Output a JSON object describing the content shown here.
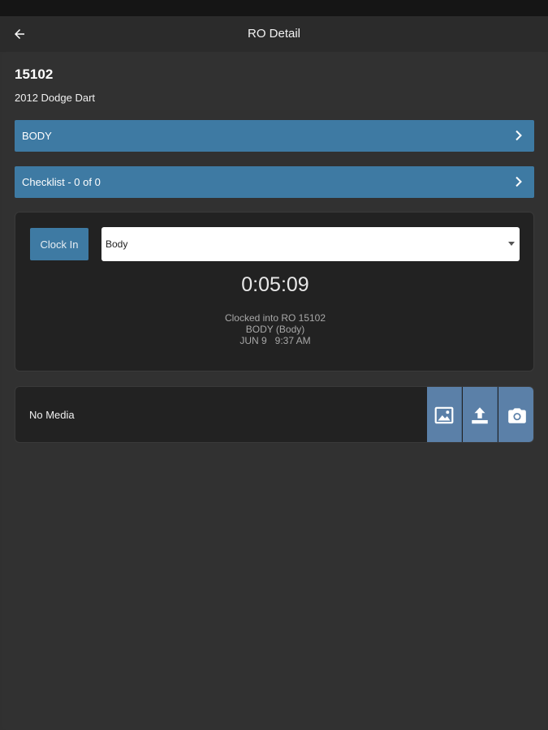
{
  "app_bar": {
    "title": "RO Detail",
    "back_icon": "arrow-left-icon"
  },
  "ro": {
    "number": "15102",
    "vehicle": "2012 Dodge Dart"
  },
  "nav_rows": [
    {
      "label": "BODY",
      "icon": "chevron-right-icon"
    },
    {
      "label": "Checklist - 0 of 0",
      "icon": "chevron-right-icon"
    }
  ],
  "clock": {
    "button_label": "Clock In",
    "selected_task": "Body",
    "timer": "0:05:09",
    "info_line_1": "Clocked into RO 15102",
    "info_line_2": "BODY (Body)",
    "info_line_3": "JUN 9   9:37 AM"
  },
  "media": {
    "empty_label": "No Media",
    "buttons": [
      {
        "icon": "gallery-icon"
      },
      {
        "icon": "upload-icon"
      },
      {
        "icon": "camera-icon"
      }
    ]
  },
  "colors": {
    "background": "#303030",
    "accent_blue": "#3e7aa3",
    "media_blue": "#5b80a8",
    "card": "#222222"
  }
}
